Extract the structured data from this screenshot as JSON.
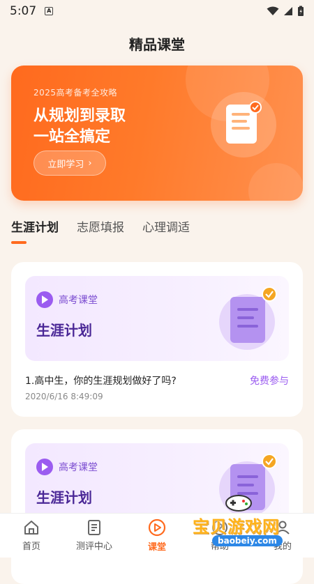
{
  "status": {
    "time": "5:07"
  },
  "page": {
    "title": "精品课堂"
  },
  "banner": {
    "subtitle": "2025高考备考全攻略",
    "headline1": "从规划到录取",
    "headline2": "一站全搞定",
    "button_label": "立即学习",
    "icon": "document-check-icon"
  },
  "tabs": [
    {
      "label": "生涯计划",
      "active": true
    },
    {
      "label": "志愿填报",
      "active": false
    },
    {
      "label": "心理调适",
      "active": false
    }
  ],
  "courses": [
    {
      "badge": "高考课堂",
      "title": "生涯计划",
      "question": "1.高中生，你的生涯规划做好了吗?",
      "action": "免费参与",
      "date": "2020/6/16 8:49:09"
    },
    {
      "badge": "高考课堂",
      "title": "生涯计划"
    }
  ],
  "nav": [
    {
      "label": "首页",
      "icon": "home-icon",
      "active": false
    },
    {
      "label": "测评中心",
      "icon": "document-icon",
      "active": false
    },
    {
      "label": "课堂",
      "icon": "play-circle-icon",
      "active": true
    },
    {
      "label": "帮助",
      "icon": "help-icon",
      "active": false
    },
    {
      "label": "我的",
      "icon": "user-icon",
      "active": false
    }
  ],
  "watermark": {
    "text": "宝贝游戏网",
    "url": "baobeiy.com"
  },
  "colors": {
    "accent": "#ff6a1e",
    "purple": "#9b5cf0",
    "background": "#faf3ec"
  }
}
